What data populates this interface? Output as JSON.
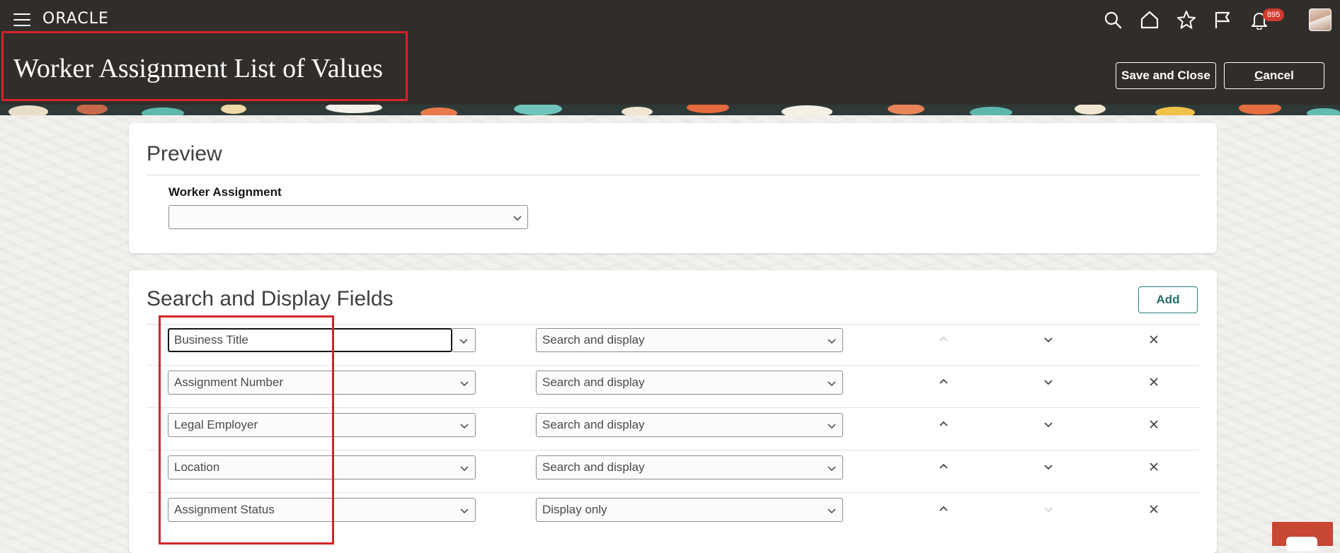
{
  "header": {
    "logo": "ORACLE",
    "page_title": "Worker Assignment List of Values",
    "notification_count": "895",
    "save_close_label": "Save and Close",
    "cancel_first": "C",
    "cancel_rest": "ancel",
    "icons": [
      "menu-icon",
      "search-icon",
      "home-icon",
      "star-icon",
      "flag-icon",
      "bell-icon"
    ]
  },
  "preview": {
    "heading": "Preview",
    "field_label": "Worker Assignment",
    "field_value": ""
  },
  "fields_section": {
    "heading": "Search and Display Fields",
    "add_label": "Add",
    "rows": [
      {
        "field": "Business Title",
        "mode": "Search and display",
        "up_enabled": false,
        "down_enabled": true
      },
      {
        "field": "Assignment Number",
        "mode": "Search and display",
        "up_enabled": true,
        "down_enabled": true
      },
      {
        "field": "Legal Employer",
        "mode": "Search and display",
        "up_enabled": true,
        "down_enabled": true
      },
      {
        "field": "Location",
        "mode": "Search and display",
        "up_enabled": true,
        "down_enabled": true
      },
      {
        "field": "Assignment Status",
        "mode": "Display only",
        "up_enabled": true,
        "down_enabled": false
      }
    ]
  },
  "colors": {
    "header_bg": "#312d2a",
    "highlight": "#d3232a",
    "accent": "#227e7b",
    "badge": "#d03b2f"
  }
}
